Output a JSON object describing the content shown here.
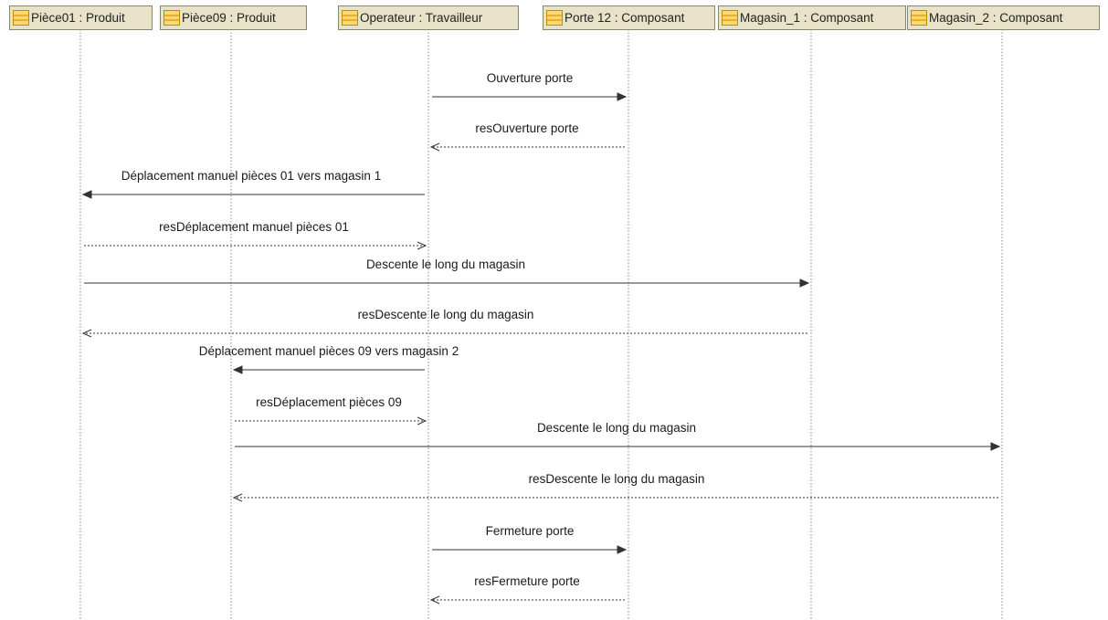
{
  "colors": {
    "header_fill": "#e7e2c8",
    "header_border": "#8a8468",
    "icon_fill": "#ffd96b",
    "icon_border": "#c28a00",
    "lifeline": "#8a8a8a",
    "message_line": "#333333"
  },
  "lifelines": [
    {
      "id": "p01",
      "label": "Pièce01 : Produit",
      "icon": "class-icon"
    },
    {
      "id": "p09",
      "label": "Pièce09 : Produit",
      "icon": "class-icon"
    },
    {
      "id": "op",
      "label": "Operateur : Travailleur",
      "icon": "class-icon"
    },
    {
      "id": "porte",
      "label": "Porte 12 : Composant",
      "icon": "class-icon"
    },
    {
      "id": "mag1",
      "label": "Magasin_1 : Composant",
      "icon": "class-icon"
    },
    {
      "id": "mag2",
      "label": "Magasin_2 : Composant",
      "icon": "class-icon"
    }
  ],
  "messages": [
    {
      "from": "op",
      "to": "porte",
      "label": "Ouverture porte",
      "kind": "call"
    },
    {
      "from": "porte",
      "to": "op",
      "label": "resOuverture porte",
      "kind": "reply"
    },
    {
      "from": "op",
      "to": "p01",
      "label": "Déplacement manuel pièces 01 vers magasin 1",
      "kind": "call"
    },
    {
      "from": "p01",
      "to": "op",
      "label": "resDéplacement manuel pièces 01",
      "kind": "reply"
    },
    {
      "from": "p01",
      "to": "mag1",
      "label": "Descente le long du magasin",
      "kind": "call"
    },
    {
      "from": "mag1",
      "to": "p01",
      "label": "resDescente le long du magasin",
      "kind": "reply"
    },
    {
      "from": "op",
      "to": "p09",
      "label": "Déplacement manuel pièces 09 vers magasin 2",
      "kind": "call"
    },
    {
      "from": "p09",
      "to": "op",
      "label": "resDéplacement pièces 09",
      "kind": "reply"
    },
    {
      "from": "p09",
      "to": "mag2",
      "label": "Descente le long du magasin",
      "kind": "call"
    },
    {
      "from": "mag2",
      "to": "p09",
      "label": "resDescente le long du magasin",
      "kind": "reply"
    },
    {
      "from": "op",
      "to": "porte",
      "label": "Fermeture porte",
      "kind": "call"
    },
    {
      "from": "porte",
      "to": "op",
      "label": "resFermeture porte",
      "kind": "reply"
    }
  ]
}
